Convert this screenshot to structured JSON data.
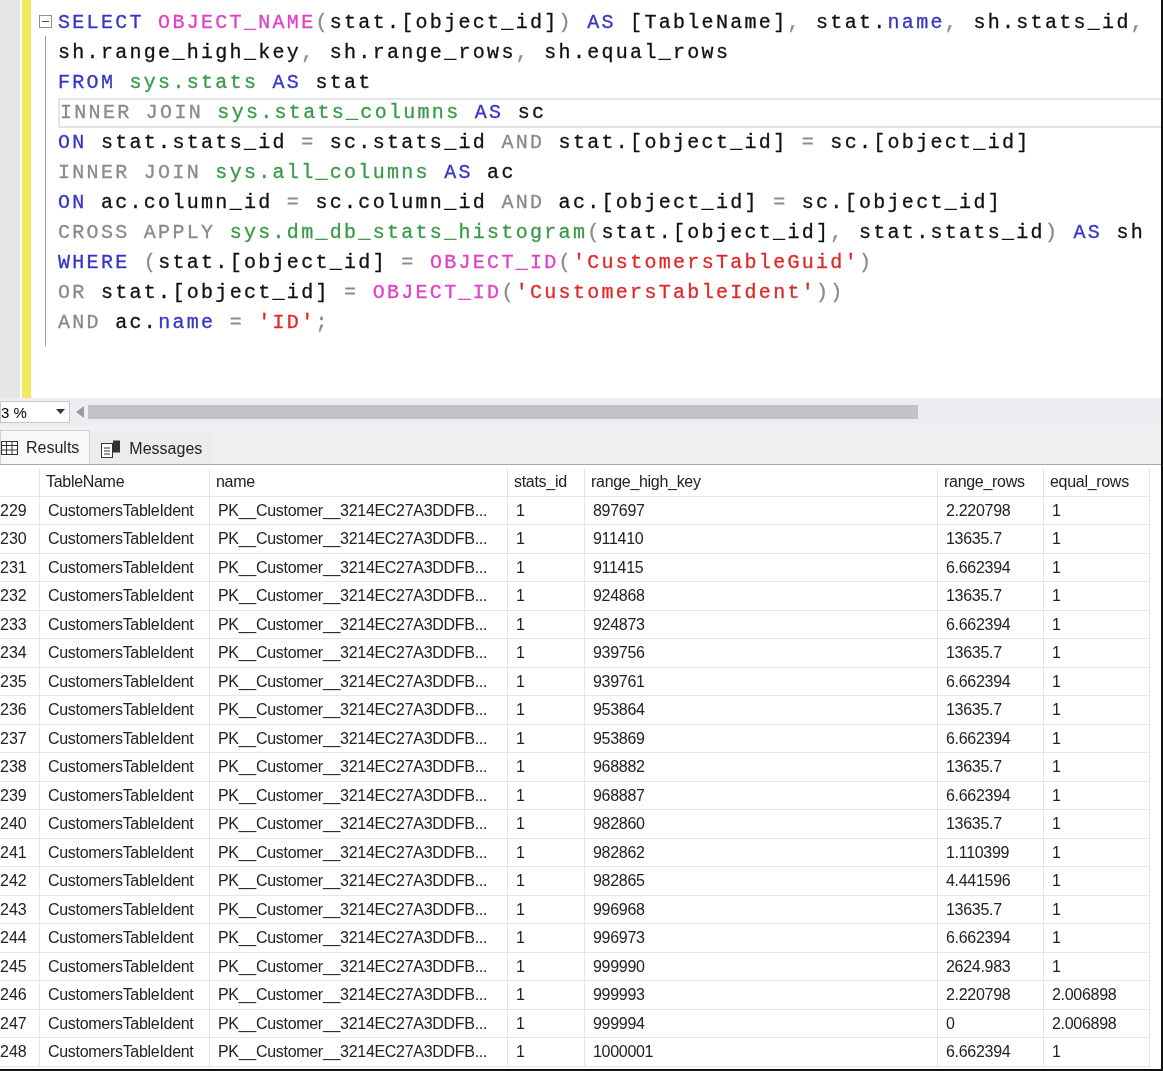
{
  "editor": {
    "lines": [
      {
        "current": false,
        "tokens": [
          {
            "kind": "keyword",
            "text": "SELECT"
          },
          {
            "kind": "function",
            "text": " OBJECT_NAME"
          },
          {
            "kind": "operator",
            "text": "("
          },
          {
            "kind": "text",
            "text": "stat.[object_id]"
          },
          {
            "kind": "operator",
            "text": ")"
          },
          {
            "kind": "keyword",
            "text": " AS"
          },
          {
            "kind": "text",
            "text": " [TableName]"
          },
          {
            "kind": "operator",
            "text": ","
          },
          {
            "kind": "text",
            "text": " stat."
          },
          {
            "kind": "keyword",
            "text": "name"
          },
          {
            "kind": "operator",
            "text": ","
          },
          {
            "kind": "text",
            "text": " sh.stats_id"
          },
          {
            "kind": "operator",
            "text": ","
          }
        ]
      },
      {
        "current": false,
        "tokens": [
          {
            "kind": "text",
            "text": "sh.range_high_key"
          },
          {
            "kind": "operator",
            "text": ","
          },
          {
            "kind": "text",
            "text": " sh.range_rows"
          },
          {
            "kind": "operator",
            "text": ","
          },
          {
            "kind": "text",
            "text": " sh.equal_rows"
          }
        ]
      },
      {
        "current": false,
        "tokens": [
          {
            "kind": "keyword",
            "text": "FROM"
          },
          {
            "kind": "object",
            "text": " sys.stats"
          },
          {
            "kind": "keyword",
            "text": " AS"
          },
          {
            "kind": "text",
            "text": " stat"
          }
        ]
      },
      {
        "current": true,
        "tokens": [
          {
            "kind": "operator",
            "text": "INNER JOIN"
          },
          {
            "kind": "object",
            "text": " sys.stats_columns"
          },
          {
            "kind": "keyword",
            "text": " AS"
          },
          {
            "kind": "text",
            "text": " sc"
          }
        ]
      },
      {
        "current": false,
        "tokens": [
          {
            "kind": "keyword",
            "text": "ON"
          },
          {
            "kind": "text",
            "text": " stat.stats_id "
          },
          {
            "kind": "operator",
            "text": "="
          },
          {
            "kind": "text",
            "text": " sc.stats_id "
          },
          {
            "kind": "operator",
            "text": "AND"
          },
          {
            "kind": "text",
            "text": " stat.[object_id] "
          },
          {
            "kind": "operator",
            "text": "="
          },
          {
            "kind": "text",
            "text": " sc.[object_id]"
          }
        ]
      },
      {
        "current": false,
        "tokens": [
          {
            "kind": "operator",
            "text": "INNER JOIN"
          },
          {
            "kind": "object",
            "text": " sys.all_columns"
          },
          {
            "kind": "keyword",
            "text": " AS"
          },
          {
            "kind": "text",
            "text": " ac"
          }
        ]
      },
      {
        "current": false,
        "tokens": [
          {
            "kind": "keyword",
            "text": "ON"
          },
          {
            "kind": "text",
            "text": " ac.column_id "
          },
          {
            "kind": "operator",
            "text": "="
          },
          {
            "kind": "text",
            "text": " sc.column_id "
          },
          {
            "kind": "operator",
            "text": "AND"
          },
          {
            "kind": "text",
            "text": " ac.[object_id] "
          },
          {
            "kind": "operator",
            "text": "="
          },
          {
            "kind": "text",
            "text": " sc.[object_id]"
          }
        ]
      },
      {
        "current": false,
        "tokens": [
          {
            "kind": "operator",
            "text": "CROSS APPLY"
          },
          {
            "kind": "object",
            "text": " sys.dm_db_stats_histogram"
          },
          {
            "kind": "operator",
            "text": "("
          },
          {
            "kind": "text",
            "text": "stat.[object_id]"
          },
          {
            "kind": "operator",
            "text": ","
          },
          {
            "kind": "text",
            "text": " stat.stats_id"
          },
          {
            "kind": "operator",
            "text": ")"
          },
          {
            "kind": "keyword",
            "text": " AS"
          },
          {
            "kind": "text",
            "text": " sh"
          }
        ]
      },
      {
        "current": false,
        "tokens": [
          {
            "kind": "keyword",
            "text": "WHERE"
          },
          {
            "kind": "operator",
            "text": " ("
          },
          {
            "kind": "text",
            "text": "stat.[object_id] "
          },
          {
            "kind": "operator",
            "text": "="
          },
          {
            "kind": "function",
            "text": " OBJECT_ID"
          },
          {
            "kind": "operator",
            "text": "("
          },
          {
            "kind": "string",
            "text": "'CustomersTableGuid'"
          },
          {
            "kind": "operator",
            "text": ")"
          }
        ]
      },
      {
        "current": false,
        "tokens": [
          {
            "kind": "operator",
            "text": "OR"
          },
          {
            "kind": "text",
            "text": " stat.[object_id] "
          },
          {
            "kind": "operator",
            "text": "="
          },
          {
            "kind": "function",
            "text": " OBJECT_ID"
          },
          {
            "kind": "operator",
            "text": "("
          },
          {
            "kind": "string",
            "text": "'CustomersTableIdent'"
          },
          {
            "kind": "operator",
            "text": "))"
          }
        ]
      },
      {
        "current": false,
        "tokens": [
          {
            "kind": "operator",
            "text": "AND"
          },
          {
            "kind": "text",
            "text": " ac."
          },
          {
            "kind": "keyword",
            "text": "name"
          },
          {
            "kind": "operator",
            "text": " ="
          },
          {
            "kind": "string",
            "text": " 'ID'"
          },
          {
            "kind": "operator",
            "text": ";"
          }
        ]
      }
    ],
    "zoom": "3 %"
  },
  "tabs": [
    {
      "label": "Results",
      "selected": true
    },
    {
      "label": "Messages",
      "selected": false
    }
  ],
  "table": {
    "columns": [
      "TableName",
      "name",
      "stats_id",
      "range_high_key",
      "range_rows",
      "equal_rows"
    ],
    "rows": [
      {
        "row": "229",
        "cells": [
          "CustomersTableIdent",
          "PK__Customer__3214EC27A3DDFB...",
          "1",
          "897697",
          "2.220798",
          "1"
        ]
      },
      {
        "row": "230",
        "cells": [
          "CustomersTableIdent",
          "PK__Customer__3214EC27A3DDFB...",
          "1",
          "911410",
          "13635.7",
          "1"
        ]
      },
      {
        "row": "231",
        "cells": [
          "CustomersTableIdent",
          "PK__Customer__3214EC27A3DDFB...",
          "1",
          "911415",
          "6.662394",
          "1"
        ]
      },
      {
        "row": "232",
        "cells": [
          "CustomersTableIdent",
          "PK__Customer__3214EC27A3DDFB...",
          "1",
          "924868",
          "13635.7",
          "1"
        ]
      },
      {
        "row": "233",
        "cells": [
          "CustomersTableIdent",
          "PK__Customer__3214EC27A3DDFB...",
          "1",
          "924873",
          "6.662394",
          "1"
        ]
      },
      {
        "row": "234",
        "cells": [
          "CustomersTableIdent",
          "PK__Customer__3214EC27A3DDFB...",
          "1",
          "939756",
          "13635.7",
          "1"
        ]
      },
      {
        "row": "235",
        "cells": [
          "CustomersTableIdent",
          "PK__Customer__3214EC27A3DDFB...",
          "1",
          "939761",
          "6.662394",
          "1"
        ]
      },
      {
        "row": "236",
        "cells": [
          "CustomersTableIdent",
          "PK__Customer__3214EC27A3DDFB...",
          "1",
          "953864",
          "13635.7",
          "1"
        ]
      },
      {
        "row": "237",
        "cells": [
          "CustomersTableIdent",
          "PK__Customer__3214EC27A3DDFB...",
          "1",
          "953869",
          "6.662394",
          "1"
        ]
      },
      {
        "row": "238",
        "cells": [
          "CustomersTableIdent",
          "PK__Customer__3214EC27A3DDFB...",
          "1",
          "968882",
          "13635.7",
          "1"
        ]
      },
      {
        "row": "239",
        "cells": [
          "CustomersTableIdent",
          "PK__Customer__3214EC27A3DDFB...",
          "1",
          "968887",
          "6.662394",
          "1"
        ]
      },
      {
        "row": "240",
        "cells": [
          "CustomersTableIdent",
          "PK__Customer__3214EC27A3DDFB...",
          "1",
          "982860",
          "13635.7",
          "1"
        ]
      },
      {
        "row": "241",
        "cells": [
          "CustomersTableIdent",
          "PK__Customer__3214EC27A3DDFB...",
          "1",
          "982862",
          "1.110399",
          "1"
        ]
      },
      {
        "row": "242",
        "cells": [
          "CustomersTableIdent",
          "PK__Customer__3214EC27A3DDFB...",
          "1",
          "982865",
          "4.441596",
          "1"
        ]
      },
      {
        "row": "243",
        "cells": [
          "CustomersTableIdent",
          "PK__Customer__3214EC27A3DDFB...",
          "1",
          "996968",
          "13635.7",
          "1"
        ]
      },
      {
        "row": "244",
        "cells": [
          "CustomersTableIdent",
          "PK__Customer__3214EC27A3DDFB...",
          "1",
          "996973",
          "6.662394",
          "1"
        ]
      },
      {
        "row": "245",
        "cells": [
          "CustomersTableIdent",
          "PK__Customer__3214EC27A3DDFB...",
          "1",
          "999990",
          "2624.983",
          "1"
        ]
      },
      {
        "row": "246",
        "cells": [
          "CustomersTableIdent",
          "PK__Customer__3214EC27A3DDFB...",
          "1",
          "999993",
          "2.220798",
          "2.006898"
        ]
      },
      {
        "row": "247",
        "cells": [
          "CustomersTableIdent",
          "PK__Customer__3214EC27A3DDFB...",
          "1",
          "999994",
          "0",
          "2.006898"
        ]
      },
      {
        "row": "248",
        "cells": [
          "CustomersTableIdent",
          "PK__Customer__3214EC27A3DDFB...",
          "1",
          "1000001",
          "6.662394",
          "1"
        ]
      }
    ]
  }
}
